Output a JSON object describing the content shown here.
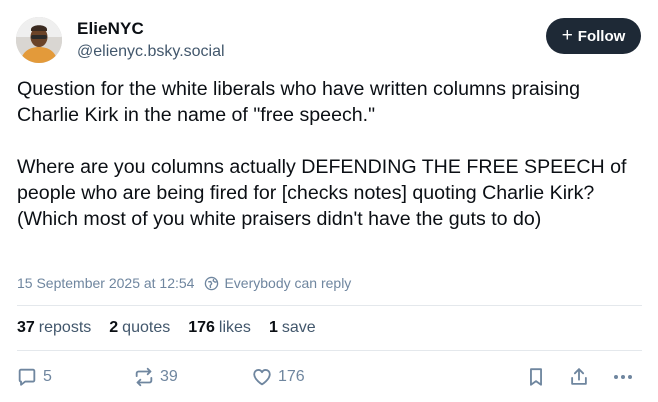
{
  "author": {
    "display_name": "ElieNYC",
    "handle": "@elienyc.bsky.social",
    "avatar_icon": "user-avatar-photo"
  },
  "follow_button": {
    "icon": "+",
    "label": "Follow"
  },
  "post": {
    "text": "Question for the white liberals who have written columns praising Charlie Kirk in the name of \"free speech.\"\n\nWhere are you columns actually DEFENDING THE FREE SPEECH of people who are being fired for [checks notes] quoting Charlie Kirk? (Which most of you white praisers didn't have the guts to do)",
    "timestamp": "15 September 2025 at 12:54",
    "reply_setting": "Everybody can reply"
  },
  "stats": {
    "reposts_count": "37",
    "reposts_label": "reposts",
    "quotes_count": "2",
    "quotes_label": "quotes",
    "likes_count": "176",
    "likes_label": "likes",
    "saves_count": "1",
    "saves_label": "save"
  },
  "actions": {
    "reply_count": "5",
    "repost_count": "39",
    "like_count": "176"
  },
  "colors": {
    "text": "#0b0f14",
    "muted": "#42576c",
    "subtle": "#6f869f",
    "follow_bg": "#1e2936",
    "divider": "#e4e8ec"
  }
}
